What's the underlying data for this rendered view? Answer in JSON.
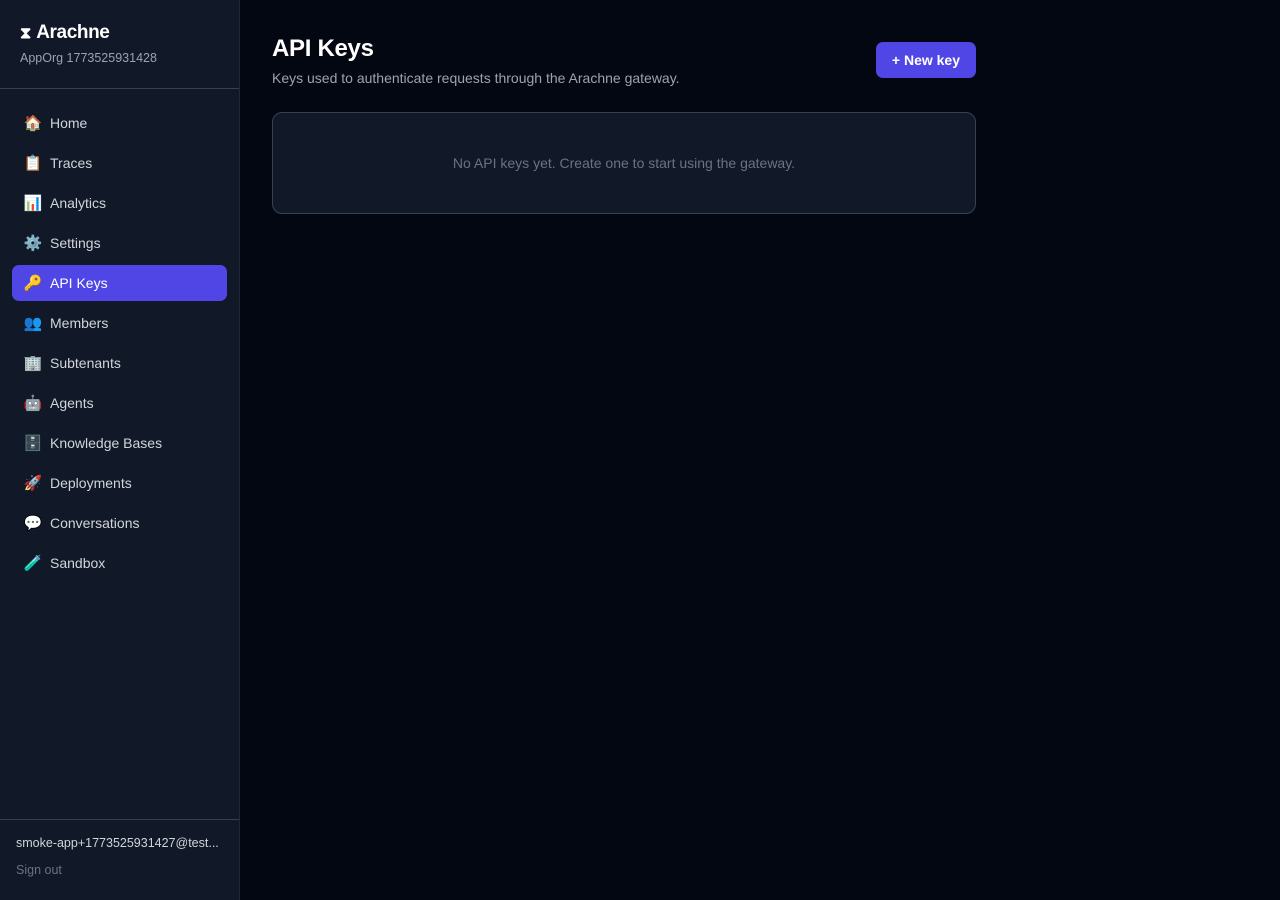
{
  "brand": {
    "logo_glyph": "⧗",
    "name": "Arachne",
    "org": "AppOrg 1773525931428"
  },
  "sidebar": {
    "items": [
      {
        "label": "Home",
        "icon": "🏠",
        "icon_name": "home-icon"
      },
      {
        "label": "Traces",
        "icon": "📋",
        "icon_name": "clipboard-icon"
      },
      {
        "label": "Analytics",
        "icon": "📊",
        "icon_name": "bar-chart-icon"
      },
      {
        "label": "Settings",
        "icon": "⚙️",
        "icon_name": "gear-icon"
      },
      {
        "label": "API Keys",
        "icon": "🔑",
        "icon_name": "key-icon",
        "active": true
      },
      {
        "label": "Members",
        "icon": "👥",
        "icon_name": "people-icon"
      },
      {
        "label": "Subtenants",
        "icon": "🏢",
        "icon_name": "building-icon"
      },
      {
        "label": "Agents",
        "icon": "🤖",
        "icon_name": "robot-icon"
      },
      {
        "label": "Knowledge Bases",
        "icon": "🗄️",
        "icon_name": "file-cabinet-icon"
      },
      {
        "label": "Deployments",
        "icon": "🚀",
        "icon_name": "rocket-icon"
      },
      {
        "label": "Conversations",
        "icon": "💬",
        "icon_name": "speech-bubble-icon"
      },
      {
        "label": "Sandbox",
        "icon": "🧪",
        "icon_name": "test-tube-icon"
      }
    ],
    "footer": {
      "email": "smoke-app+1773525931427@test...",
      "sign_out": "Sign out"
    }
  },
  "main": {
    "title": "API Keys",
    "subtitle": "Keys used to authenticate requests through the Arachne gateway.",
    "new_key_label": "+ New key",
    "empty_text": "No API keys yet. Create one to start using the gateway."
  },
  "colors": {
    "accent": "#4f46e5",
    "background": "#030712",
    "sidebar": "#111827"
  }
}
